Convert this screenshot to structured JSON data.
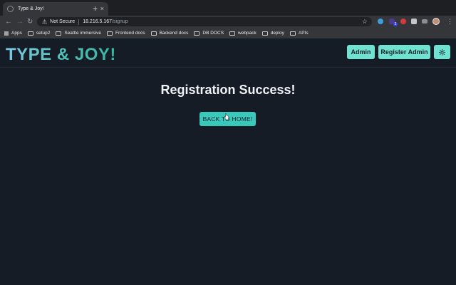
{
  "browser": {
    "tab_title": "Type & Joy!",
    "tab_close": "×",
    "new_tab": "+",
    "back": "←",
    "forward": "→",
    "reload": "↻",
    "security_icon": "⚠",
    "security_label": "Not Secure",
    "url_host": "18.216.5.167",
    "url_path": "/signup",
    "star": "☆",
    "menu": "⋮",
    "extension_badge": "2",
    "bookmarks": [
      {
        "label": "Apps",
        "icon": "apps-grid-icon"
      },
      {
        "label": "setup2",
        "icon": "folder-icon"
      },
      {
        "label": "Seattle immersive",
        "icon": "folder-icon"
      },
      {
        "label": "Frontend docs",
        "icon": "folder-icon"
      },
      {
        "label": "Backend docs",
        "icon": "folder-icon"
      },
      {
        "label": "DB DOCS",
        "icon": "folder-icon"
      },
      {
        "label": "webpack",
        "icon": "folder-icon"
      },
      {
        "label": "deploy",
        "icon": "folder-icon"
      },
      {
        "label": "APIs",
        "icon": "folder-icon"
      }
    ]
  },
  "app": {
    "logo": "TYPE & JOY!",
    "nav": {
      "admin_label": "Admin",
      "register_admin_label": "Register Admin",
      "theme_icon": "sun-icon"
    },
    "main": {
      "title": "Registration Success!",
      "home_button_label": "BACK TO HOME!"
    }
  },
  "colors": {
    "page_bg": "#151c25",
    "accent": "#6fe3cf",
    "home_button": "#39c9bb",
    "text": "#edf2f7"
  }
}
